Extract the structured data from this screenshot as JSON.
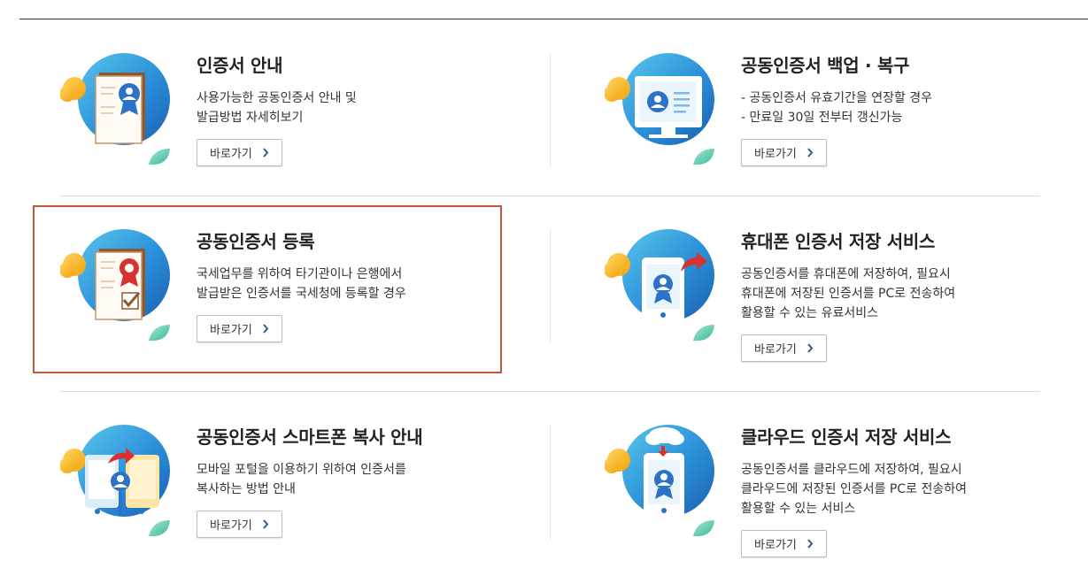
{
  "cards": [
    {
      "title": "인증서 안내",
      "desc": [
        "사용가능한 공동인증서 안내 및",
        "발급방법 자세히보기"
      ],
      "button": "바로가기"
    },
    {
      "title": "공동인증서 백업 · 복구",
      "desc": [
        "- 공동인증서 유효기간을 연장할 경우",
        "- 만료일 30일 전부터 갱신가능"
      ],
      "button": "바로가기"
    },
    {
      "title": "공동인증서 등록",
      "desc": [
        "국세업무를 위하여 타기관이나 은행에서",
        "발급받은 인증서를 국세청에 등록할 경우"
      ],
      "button": "바로가기"
    },
    {
      "title": "휴대폰 인증서 저장 서비스",
      "desc": [
        "공동인증서를 휴대폰에 저장하여, 필요시",
        "휴대폰에 저장된 인증서를 PC로 전송하여",
        "활용할 수 있는 유료서비스"
      ],
      "button": "바로가기"
    },
    {
      "title": "공동인증서 스마트폰 복사 안내",
      "desc": [
        "모바일 포털을 이용하기 위하여 인증서를",
        "복사하는 방법 안내"
      ],
      "button": "바로가기"
    },
    {
      "title": "클라우드 인증서 저장 서비스",
      "desc": [
        "공동인증서를 클라우드에 저장하여, 필요시",
        "클라우드에 저장된 인증서를 PC로 전송하여",
        "활용할 수 있는 서비스"
      ],
      "button": "바로가기"
    }
  ],
  "icons": [
    "certificate-icon",
    "monitor-certificate-icon",
    "certificate-check-icon",
    "phone-transfer-icon",
    "smartphone-copy-icon",
    "cloud-phone-icon"
  ],
  "colors": {
    "highlight": "#c0593d",
    "circle": "#2f8fd8",
    "leaf": "#6cc9b3",
    "accent": "#f5b82e",
    "ribbon": "#d7322e"
  }
}
